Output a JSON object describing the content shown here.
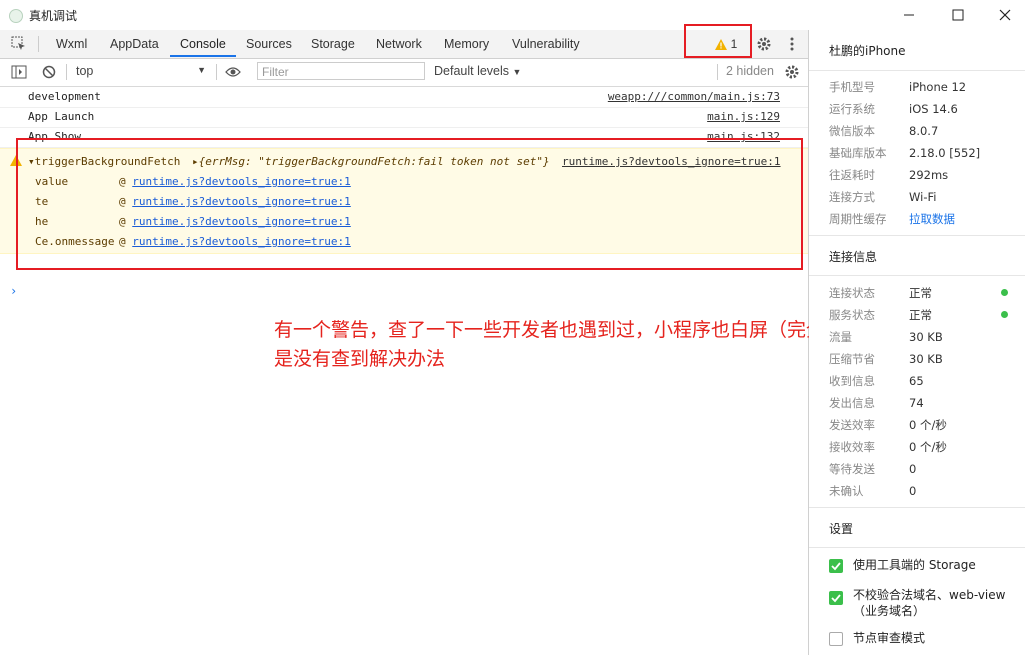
{
  "window": {
    "title": "真机调试"
  },
  "tabs": [
    {
      "label": "Wxml"
    },
    {
      "label": "AppData"
    },
    {
      "label": "Console"
    },
    {
      "label": "Sources"
    },
    {
      "label": "Storage"
    },
    {
      "label": "Network"
    },
    {
      "label": "Memory"
    },
    {
      "label": "Vulnerability"
    }
  ],
  "toolbar": {
    "warning_count": "1"
  },
  "filterbar": {
    "context": "top",
    "filter_placeholder": "Filter",
    "levels": "Default levels",
    "hidden": "2 hidden"
  },
  "console": {
    "logs": [
      {
        "message": "development",
        "source": "weapp:///common/main.js:73"
      },
      {
        "message": "App Launch",
        "source": "main.js:129"
      },
      {
        "message": "App Show",
        "source": "main.js:132"
      }
    ],
    "warning": {
      "name": "triggerBackgroundFetch",
      "object": "{errMsg: \"triggerBackgroundFetch:fail token not set\"}",
      "source": "runtime.js?devtools_ignore=true:1",
      "trace": [
        {
          "fn": "value",
          "link": "runtime.js?devtools_ignore=true:1"
        },
        {
          "fn": "te",
          "link": "runtime.js?devtools_ignore=true:1"
        },
        {
          "fn": "he",
          "link": "runtime.js?devtools_ignore=true:1"
        },
        {
          "fn": "Ce.onmessage",
          "link": "runtime.js?devtools_ignore=true:1"
        }
      ]
    },
    "prompt": "›"
  },
  "annotation": "有一个警告，查了一下一些开发者也遇到过，小程序也白屏（完全不渲染那种），但是没有查到解决办法",
  "side": {
    "device": "杜鹏的iPhone",
    "info": [
      {
        "k": "手机型号",
        "v": "iPhone 12"
      },
      {
        "k": "运行系统",
        "v": "iOS 14.6"
      },
      {
        "k": "微信版本",
        "v": "8.0.7"
      },
      {
        "k": "基础库版本",
        "v": "2.18.0 [552]"
      },
      {
        "k": "往返耗时",
        "v": "292ms"
      },
      {
        "k": "连接方式",
        "v": "Wi-Fi"
      },
      {
        "k": "周期性缓存",
        "v": "拉取数据"
      }
    ],
    "connection_title": "连接信息",
    "connection": [
      {
        "k": "连接状态",
        "v": "正常"
      },
      {
        "k": "服务状态",
        "v": "正常"
      },
      {
        "k": "流量",
        "v": "30 KB"
      },
      {
        "k": "压缩节省",
        "v": "30 KB"
      },
      {
        "k": "收到信息",
        "v": "65"
      },
      {
        "k": "发出信息",
        "v": "74"
      },
      {
        "k": "发送效率",
        "v": "0 个/秒"
      },
      {
        "k": "接收效率",
        "v": "0 个/秒"
      },
      {
        "k": "等待发送",
        "v": "0"
      },
      {
        "k": "未确认",
        "v": "0"
      }
    ],
    "settings_title": "设置",
    "settings": [
      {
        "label": "使用工具端的 Storage",
        "checked": true
      },
      {
        "label": "不校验合法域名、web-view（业务域名）",
        "checked": true
      },
      {
        "label": "节点审查模式",
        "checked": false
      }
    ]
  },
  "colors": {
    "accent": "#1a73e8",
    "highlight": "#e51c23",
    "ok": "#3bbf4b",
    "warn_bg": "#fffbe6"
  }
}
